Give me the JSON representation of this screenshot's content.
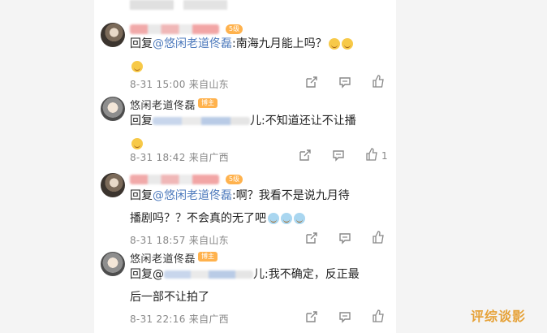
{
  "comments": [
    {
      "user_is_blurred": true,
      "badge": "5级",
      "text_prefix": "回复",
      "mention": "@悠闲老道佟磊",
      "text_body": ":南海九月能上吗？",
      "time": "8-31 15:00",
      "location": "来自山东",
      "like_count": ""
    },
    {
      "username": "悠闲老道佟磊",
      "badge": "博主",
      "text_prefix": "回复",
      "text_body": "儿:不知道还让不让播",
      "time": "8-31 18:42",
      "location": "来自广西",
      "like_count": "1"
    },
    {
      "user_is_blurred": true,
      "badge": "5级",
      "text_prefix": "回复",
      "mention": "@悠闲老道佟磊",
      "text_body": ":啊？我看不是说九月待",
      "text_line2": "播剧吗？？不会真的无了吧",
      "time": "8-31 18:57",
      "location": "来自山东",
      "like_count": ""
    },
    {
      "username": "悠闲老道佟磊",
      "badge": "博主",
      "text_prefix": "回复@",
      "text_body": "儿:我不确定，反正最",
      "text_line2": "后一部不让拍了",
      "time": "8-31 22:16",
      "location": "来自广西",
      "like_count": ""
    }
  ],
  "icons": [
    "share-icon",
    "comment-icon",
    "like-icon"
  ],
  "colors": {
    "mention": "#4f7bbd",
    "badge": "#ffb24d",
    "watermark": "#e6a238"
  },
  "watermark": "评综谈影"
}
